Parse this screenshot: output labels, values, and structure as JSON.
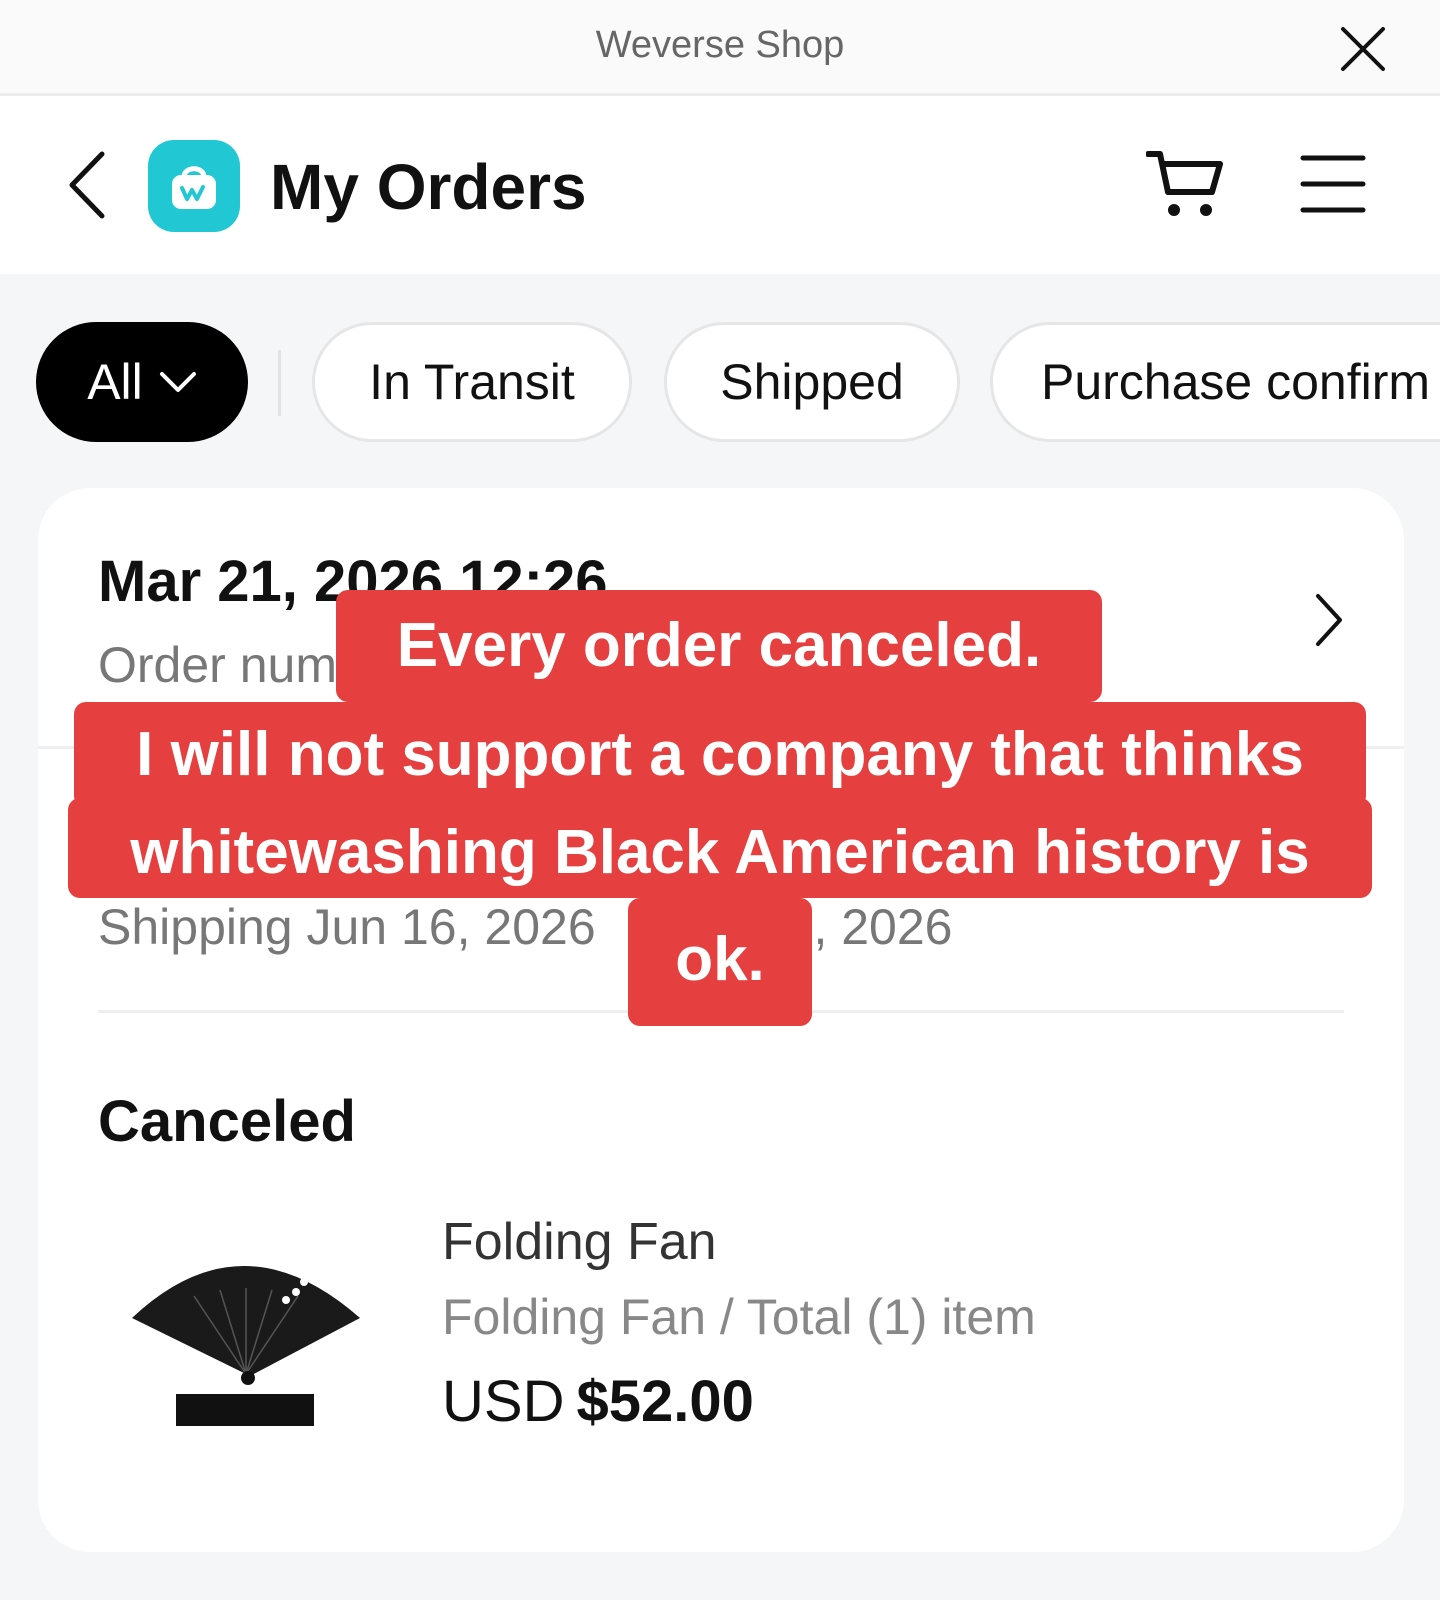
{
  "browser": {
    "title": "Weverse Shop",
    "close_icon": "close-icon"
  },
  "header": {
    "title": "My Orders",
    "back_icon": "chevron-left-icon",
    "logo_icon": "shopping-bag-icon",
    "cart_icon": "cart-icon",
    "menu_icon": "hamburger-menu-icon"
  },
  "filters": {
    "all_label": "All",
    "chips": [
      "In Transit",
      "Shipped",
      "Purchase confirm"
    ]
  },
  "order": {
    "date": "Mar 21, 2026 12:26",
    "order_number_label": "Order num",
    "shipping_left": "Shipping Jun 16, 2026",
    "shipping_right": "0, 2026",
    "status": "Canceled",
    "product": {
      "name": "Folding Fan",
      "variant": "Folding Fan / Total (1) item",
      "currency": "USD",
      "price": "$52.00"
    }
  },
  "caption": {
    "line1": "Every order canceled.",
    "line2": "I will not support a company that thinks",
    "line3": "whitewashing Black American history is",
    "line4": "ok."
  },
  "colors": {
    "brand": "#21c7d3",
    "caption_bg": "#e63f3f",
    "chip_active_bg": "#000000",
    "page_bg": "#f5f6f7"
  }
}
